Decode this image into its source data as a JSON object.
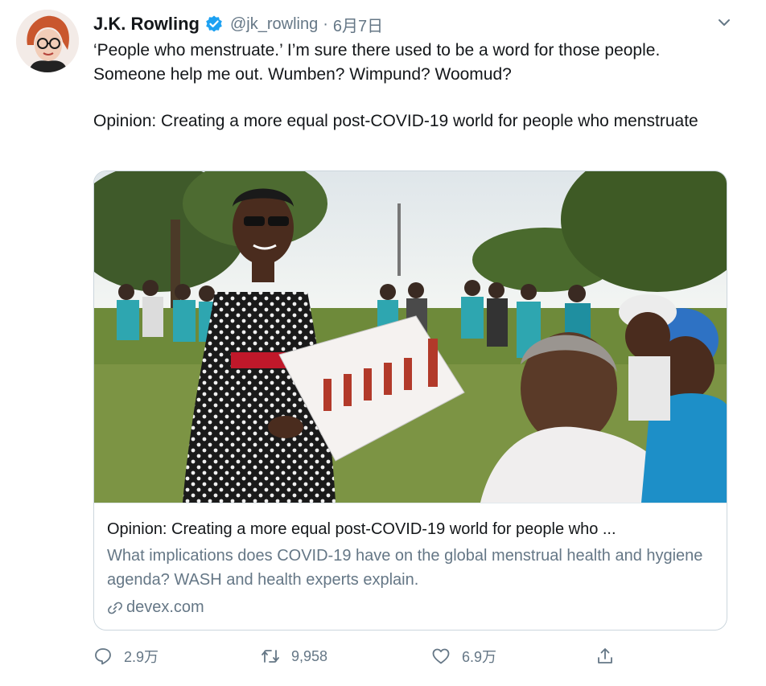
{
  "tweet": {
    "author_name": "J.K. Rowling",
    "handle": "@jk_rowling",
    "separator": "·",
    "date": "6月7日",
    "text_line1": "‘People who menstruate.’ I’m sure there used to be a word for those people. Someone help me out. Wumben? Wimpund? Woomud?",
    "text_line2": "Opinion: Creating a more equal post-COVID-19 world for people who menstruate"
  },
  "card": {
    "title": "Opinion: Creating a more equal post-COVID-19 world for people who ...",
    "description": "What implications does COVID-19 have on the global menstrual health and hygiene agenda? WASH and health experts explain.",
    "domain": "devex.com"
  },
  "actions": {
    "reply_count": "2.9万",
    "retweet_count": "9,958",
    "like_count": "6.9万"
  },
  "icons": {
    "verified": "verified-badge-icon",
    "more": "chevron-down-icon",
    "link": "link-icon",
    "reply": "reply-icon",
    "retweet": "retweet-icon",
    "like": "heart-icon",
    "share": "share-icon"
  },
  "colors": {
    "verified_blue": "#1da1f2",
    "secondary_text": "#657786",
    "primary_text": "#14171a",
    "card_border": "#ccd6dd"
  }
}
